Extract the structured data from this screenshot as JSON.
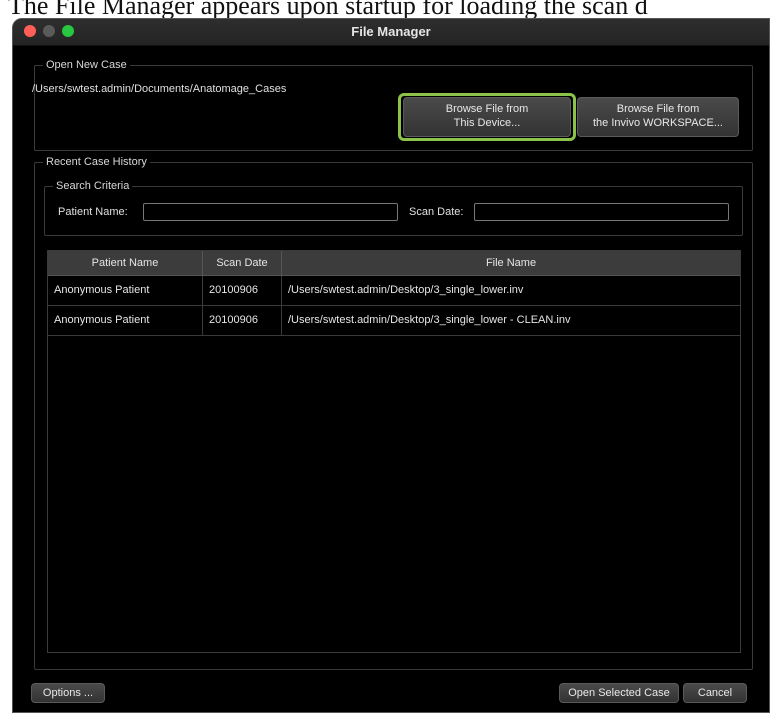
{
  "caption": "The File Manager appears upon startup for loading the scan d",
  "window": {
    "title": "File Manager"
  },
  "open_new_case": {
    "label": "Open New Case",
    "path": "/Users/swtest.admin/Documents/Anatomage_Cases",
    "browse_device": {
      "line1": "Browse File from",
      "line2": "This Device..."
    },
    "browse_workspace": {
      "line1": "Browse File from",
      "line2": "the Invivo WORKSPACE..."
    },
    "highlight_color": "#8bc34a"
  },
  "recent_history": {
    "label": "Recent Case History",
    "search_criteria": {
      "label": "Search Criteria",
      "patient_name_label": "Patient Name:",
      "patient_name_value": "",
      "scan_date_label": "Scan Date:",
      "scan_date_value": ""
    },
    "table": {
      "columns": [
        "Patient Name",
        "Scan Date",
        "File Name"
      ],
      "rows": [
        {
          "patient": "Anonymous Patient",
          "date": "20100906",
          "file": "/Users/swtest.admin/Desktop/3_single_lower.inv"
        },
        {
          "patient": "Anonymous Patient",
          "date": "20100906",
          "file": "/Users/swtest.admin/Desktop/3_single_lower - CLEAN.inv"
        }
      ]
    }
  },
  "footer": {
    "options_label": "Options ...",
    "open_selected_label": "Open Selected Case",
    "cancel_label": "Cancel"
  }
}
